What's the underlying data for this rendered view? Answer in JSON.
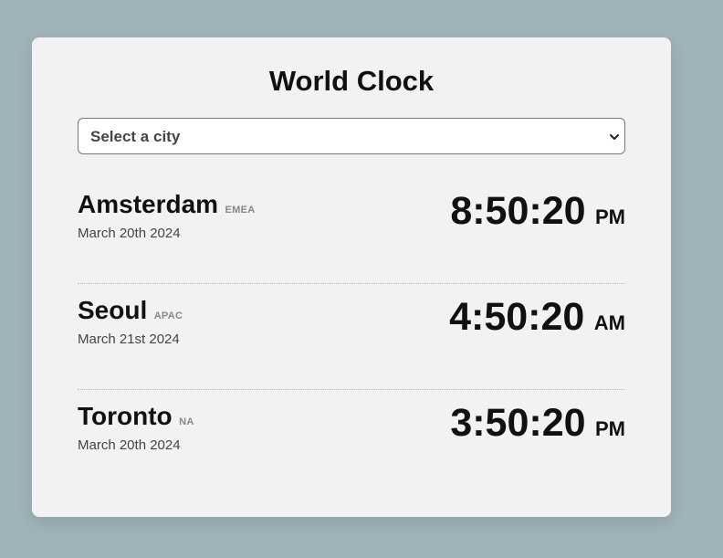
{
  "app": {
    "title": "World Clock"
  },
  "select": {
    "value": "Select a city"
  },
  "cities": [
    {
      "name": "Amsterdam",
      "region": "EMEA",
      "date": "March 20th 2024",
      "time": "8:50:20",
      "ampm": "PM"
    },
    {
      "name": "Seoul",
      "region": "APAC",
      "date": "March 21st 2024",
      "time": "4:50:20",
      "ampm": "AM"
    },
    {
      "name": "Toronto",
      "region": "NA",
      "date": "March 20th 2024",
      "time": "3:50:20",
      "ampm": "PM"
    }
  ],
  "icons": {
    "dropdown": "chevron-down-icon"
  },
  "colors": {
    "background": "#9fb3b9",
    "card": "#f2f2f2",
    "text": "#111111",
    "region": "#888888"
  }
}
